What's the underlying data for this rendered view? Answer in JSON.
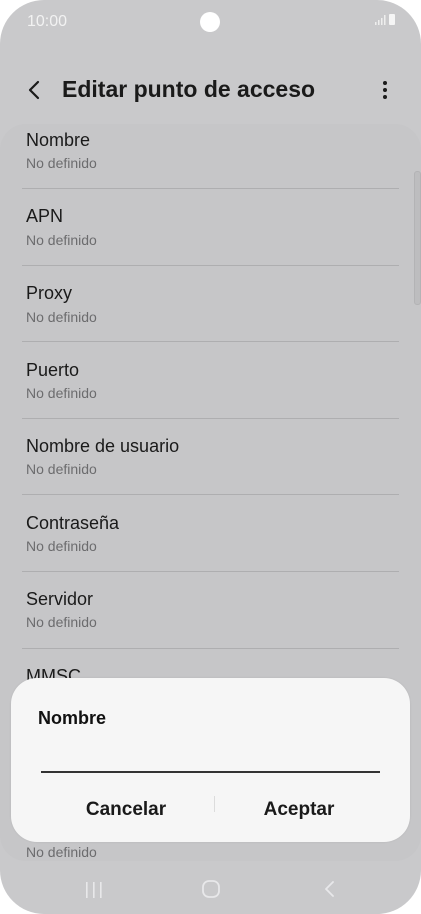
{
  "status": {
    "time": "10:00"
  },
  "header": {
    "title": "Editar punto de acceso"
  },
  "items": [
    {
      "label": "Nombre",
      "value": "No definido"
    },
    {
      "label": "APN",
      "value": "No definido"
    },
    {
      "label": "Proxy",
      "value": "No definido"
    },
    {
      "label": "Puerto",
      "value": "No definido"
    },
    {
      "label": "Nombre de usuario",
      "value": "No definido"
    },
    {
      "label": "Contraseña",
      "value": "No definido"
    },
    {
      "label": "Servidor",
      "value": "No definido"
    },
    {
      "label": "MMSC",
      "value": ""
    }
  ],
  "bottom_visible_value": "No definido",
  "dialog": {
    "title": "Nombre",
    "input_value": "",
    "cancel_label": "Cancelar",
    "accept_label": "Aceptar"
  },
  "colors": {
    "background": "#c9c9cb",
    "dialog": "#f6f6f6",
    "text": "#1a1a1a",
    "secondary_text": "#6c6c6e"
  },
  "icons": {
    "back": "chevron-left-icon",
    "more": "more-vert-icon",
    "nav_recents": "recents-icon",
    "nav_home": "home-icon",
    "nav_back": "nav-back-icon"
  }
}
